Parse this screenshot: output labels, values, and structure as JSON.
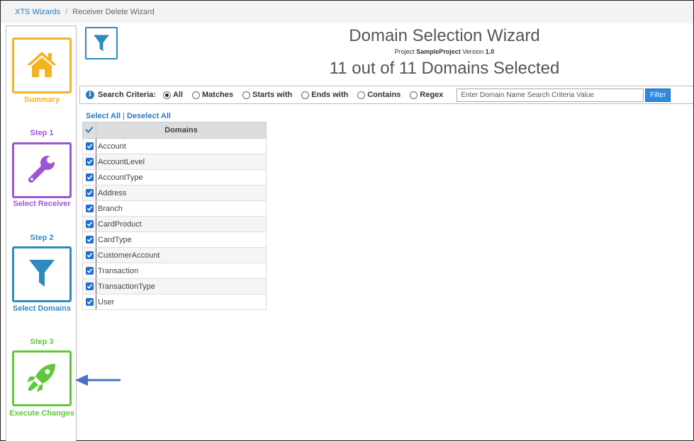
{
  "breadcrumb": {
    "root": "XTS Wizards",
    "separator": "/",
    "current": "Receiver Delete Wizard"
  },
  "sidebar": {
    "summary": {
      "label": "Summary",
      "icon": "home-icon",
      "color": "#f5b324"
    },
    "step1": {
      "step": "Step 1",
      "label": "Select Receiver",
      "icon": "wrench-icon",
      "color": "#9b55d3"
    },
    "step2": {
      "step": "Step 2",
      "label": "Select Domains",
      "icon": "filter-icon",
      "color": "#2e8bbd"
    },
    "step3": {
      "step": "Step 3",
      "label": "Execute Changes",
      "icon": "rocket-icon",
      "color": "#5fc83a"
    }
  },
  "header": {
    "title": "Domain Selection Wizard",
    "project_prefix": "Project",
    "project_name": "SampleProject",
    "version_prefix": "Version",
    "version": "1.0",
    "count_text": "11 out of 11 Domains Selected"
  },
  "criteria": {
    "label": "Search Criteria:",
    "options": [
      "All",
      "Matches",
      "Starts with",
      "Ends with",
      "Contains",
      "Regex"
    ],
    "selected": "All",
    "placeholder": "Enter Domain Name Search Criteria Value",
    "filter_label": "Filter"
  },
  "selection": {
    "select_all": "Select All",
    "separator": "|",
    "deselect_all": "Deselect All"
  },
  "table": {
    "header": "Domains",
    "rows": [
      "Account",
      "AccountLevel",
      "AccountType",
      "Address",
      "Branch",
      "CardProduct",
      "CardType",
      "CustomerAccount",
      "Transaction",
      "TransactionType",
      "User"
    ]
  },
  "colors": {
    "accent": "#2a7bbf",
    "checkbox": "#1e6fd0",
    "arrow": "#4472c4"
  }
}
